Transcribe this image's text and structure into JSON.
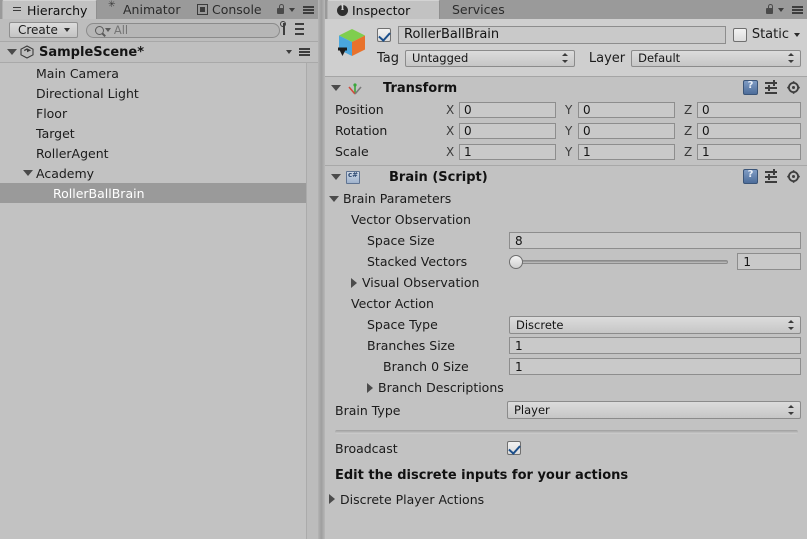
{
  "hierarchy": {
    "tabs": [
      {
        "label": "Hierarchy",
        "icon": "hierarchy-icon",
        "active": true
      },
      {
        "label": "Animator",
        "icon": "animator-icon",
        "active": false
      },
      {
        "label": "Console",
        "icon": "console-icon",
        "active": false
      }
    ],
    "toolbar": {
      "create_label": "Create",
      "search_value": "",
      "search_placeholder": "All"
    },
    "scene": {
      "name": "SampleScene*",
      "expanded": true
    },
    "nodes": [
      {
        "label": "Main Camera",
        "depth": 1,
        "foldout": "none",
        "selected": false
      },
      {
        "label": "Directional Light",
        "depth": 1,
        "foldout": "none",
        "selected": false
      },
      {
        "label": "Floor",
        "depth": 1,
        "foldout": "none",
        "selected": false
      },
      {
        "label": "Target",
        "depth": 1,
        "foldout": "none",
        "selected": false
      },
      {
        "label": "RollerAgent",
        "depth": 1,
        "foldout": "none",
        "selected": false
      },
      {
        "label": "Academy",
        "depth": 1,
        "foldout": "open",
        "selected": false
      },
      {
        "label": "RollerBallBrain",
        "depth": 2,
        "foldout": "none",
        "selected": true
      }
    ]
  },
  "inspector": {
    "tabs": [
      {
        "label": "Inspector",
        "icon": "info-icon",
        "active": true
      },
      {
        "label": "Services",
        "icon": "none",
        "active": false
      }
    ],
    "object": {
      "enabled": true,
      "name": "RollerBallBrain",
      "static_label": "Static",
      "static_checked": false,
      "tag_label": "Tag",
      "tag_value": "Untagged",
      "layer_label": "Layer",
      "layer_value": "Default"
    },
    "transform": {
      "title": "Transform",
      "expanded": true,
      "rows": [
        {
          "label": "Position",
          "x": "0",
          "y": "0",
          "z": "0"
        },
        {
          "label": "Rotation",
          "x": "0",
          "y": "0",
          "z": "0"
        },
        {
          "label": "Scale",
          "x": "1",
          "y": "1",
          "z": "1"
        }
      ],
      "axes": [
        "X",
        "Y",
        "Z"
      ]
    },
    "brain": {
      "title": "Brain (Script)",
      "expanded": true,
      "brain_parameters_label": "Brain Parameters",
      "vector_observation_label": "Vector Observation",
      "space_size_label": "Space Size",
      "space_size_value": "8",
      "stacked_vectors_label": "Stacked Vectors",
      "stacked_vectors_value": "1",
      "stacked_vectors_slider_pct": 0,
      "visual_observation_label": "Visual Observation",
      "vector_action_label": "Vector Action",
      "space_type_label": "Space Type",
      "space_type_value": "Discrete",
      "branches_size_label": "Branches Size",
      "branches_size_value": "1",
      "branch0_size_label": "Branch 0 Size",
      "branch0_size_value": "1",
      "branch_descriptions_label": "Branch Descriptions",
      "brain_type_label": "Brain Type",
      "brain_type_value": "Player",
      "broadcast_label": "Broadcast",
      "broadcast_checked": true,
      "note": "Edit the discrete inputs for your actions",
      "discrete_player_actions_label": "Discrete Player Actions"
    }
  },
  "colors": {
    "panel_bg": "#c2c2c2",
    "tabbar_bg": "#9a9a9a",
    "selection": "#9a9a9a",
    "field_bg": "#c9c9c9",
    "field_border": "#8d8d8d",
    "check_blue": "#1c4f8b"
  }
}
